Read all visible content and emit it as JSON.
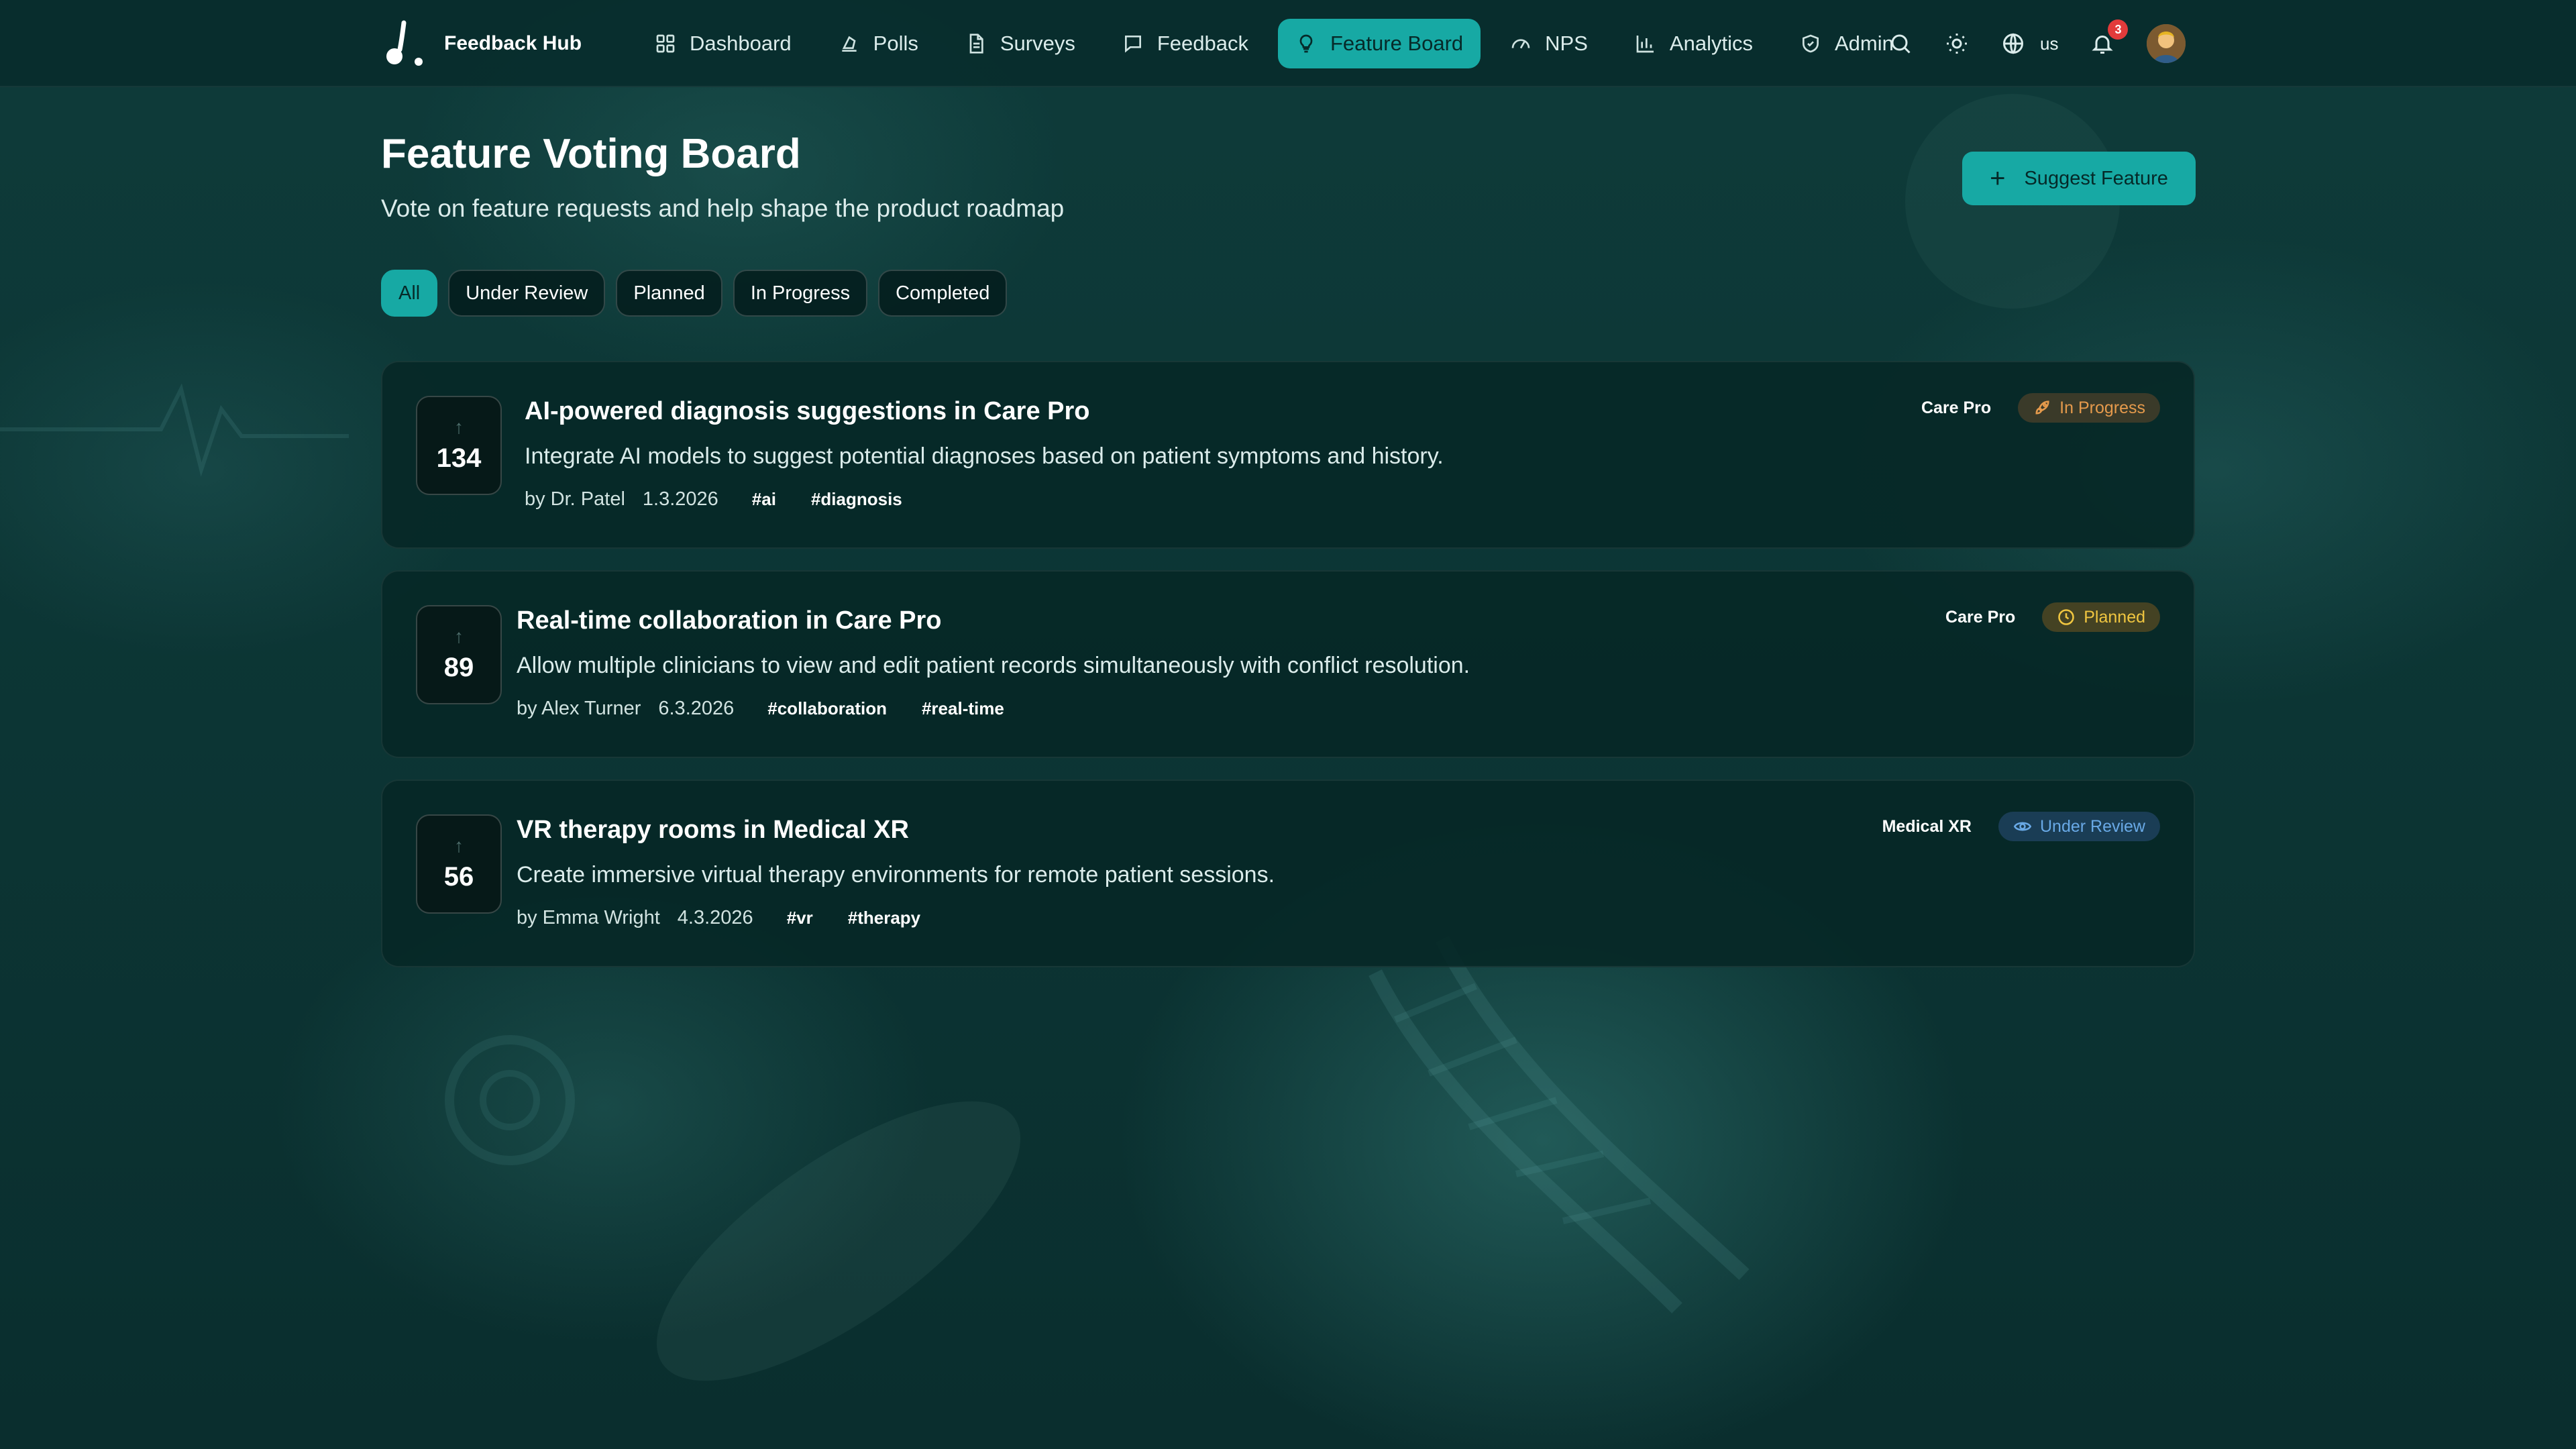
{
  "app": {
    "brand": "Feedback Hub"
  },
  "nav": [
    {
      "label": "Dashboard",
      "icon": "dashboard-icon"
    },
    {
      "label": "Polls",
      "icon": "poll-icon"
    },
    {
      "label": "Surveys",
      "icon": "document-icon"
    },
    {
      "label": "Feedback",
      "icon": "chat-icon"
    },
    {
      "label": "Feature Board",
      "icon": "lightbulb-icon",
      "active": true
    },
    {
      "label": "NPS",
      "icon": "gauge-icon"
    },
    {
      "label": "Analytics",
      "icon": "bar-chart-icon"
    },
    {
      "label": "Admin",
      "icon": "shield-icon"
    }
  ],
  "tools": {
    "language": "us",
    "notifications": "3"
  },
  "header": {
    "title": "Feature Voting Board",
    "subtitle": "Vote on feature requests and help shape the product roadmap",
    "suggest_label": "Suggest Feature"
  },
  "filters": [
    "All",
    "Under Review",
    "Planned",
    "In Progress",
    "Completed"
  ],
  "active_filter": "All",
  "features": [
    {
      "votes": "134",
      "title": "AI-powered diagnosis suggestions in Care Pro",
      "description": "Integrate AI models to suggest potential diagnoses based on patient symptoms and history.",
      "author": "by Dr. Patel",
      "date": "1.3.2026",
      "tags": [
        "#ai",
        "#diagnosis"
      ],
      "product": "Care Pro",
      "status": "In Progress",
      "status_icon": "rocket-icon",
      "status_color": "#e59a4c"
    },
    {
      "votes": "89",
      "title": "Real-time collaboration in Care Pro",
      "description": "Allow multiple clinicians to view and edit patient records simultaneously with conflict resolution.",
      "author": "by Alex Turner",
      "date": "6.3.2026",
      "tags": [
        "#collaboration",
        "#real-time"
      ],
      "product": "Care Pro",
      "status": "Planned",
      "status_icon": "clock-icon",
      "status_color": "#f0c640"
    },
    {
      "votes": "56",
      "title": "VR therapy rooms in Medical XR",
      "description": "Create immersive virtual therapy environments for remote patient sessions.",
      "author": "by Emma Wright",
      "date": "4.3.2026",
      "tags": [
        "#vr",
        "#therapy"
      ],
      "product": "Medical XR",
      "status": "Under Review",
      "status_icon": "eye-icon",
      "status_color": "#69a9e6"
    }
  ],
  "colors": {
    "accent": "#17a9a4",
    "background": "#0c3534"
  }
}
